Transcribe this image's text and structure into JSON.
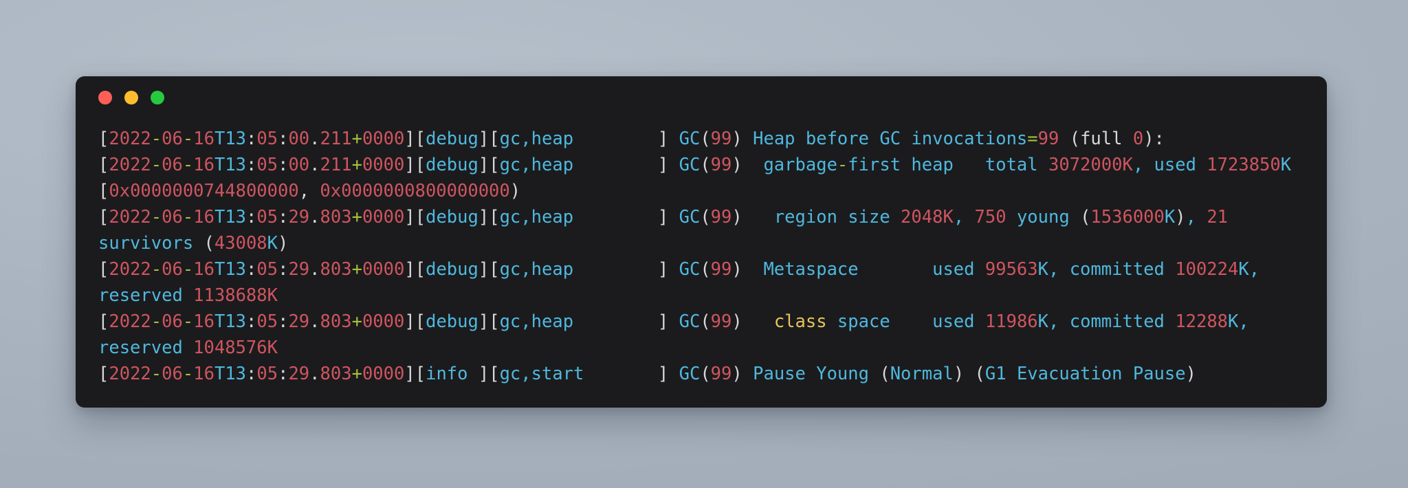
{
  "window": {
    "title": "",
    "controls": [
      {
        "name": "close",
        "color": "#ff5f56"
      },
      {
        "name": "minimize",
        "color": "#ffbd2e"
      },
      {
        "name": "zoom",
        "color": "#27c93f"
      }
    ]
  },
  "theme": {
    "desktop_background": "#aab4c0",
    "terminal_background": "#1b1b1d",
    "white": "#d8d8d8",
    "red": "#cf5560",
    "cyan": "#4fb8de",
    "green": "#a6c23a",
    "yellow": "#e5c55a"
  },
  "terminal": {
    "lines": [
      {
        "id": "line-1",
        "plain": "[2022-06-16T13:05:00.211+0000][debug][gc,heap        ] GC(99) Heap before GC invocations=99 (full 0):",
        "tokens": [
          {
            "t": "[",
            "c": "w"
          },
          {
            "t": "2022",
            "c": "r"
          },
          {
            "t": "-",
            "c": "g"
          },
          {
            "t": "06",
            "c": "r"
          },
          {
            "t": "-",
            "c": "g"
          },
          {
            "t": "16",
            "c": "r"
          },
          {
            "t": "T",
            "c": "c"
          },
          {
            "t": "13",
            "c": "c"
          },
          {
            "t": ":",
            "c": "w"
          },
          {
            "t": "05",
            "c": "r"
          },
          {
            "t": ":",
            "c": "w"
          },
          {
            "t": "00",
            "c": "r"
          },
          {
            "t": ".",
            "c": "w"
          },
          {
            "t": "211",
            "c": "r"
          },
          {
            "t": "+",
            "c": "g"
          },
          {
            "t": "0000",
            "c": "r"
          },
          {
            "t": "][",
            "c": "w"
          },
          {
            "t": "debug",
            "c": "c"
          },
          {
            "t": "][",
            "c": "w"
          },
          {
            "t": "gc,heap",
            "c": "c"
          },
          {
            "t": "        ",
            "c": "w"
          },
          {
            "t": "] ",
            "c": "w"
          },
          {
            "t": "GC",
            "c": "c"
          },
          {
            "t": "(",
            "c": "w"
          },
          {
            "t": "99",
            "c": "r"
          },
          {
            "t": ") ",
            "c": "w"
          },
          {
            "t": "Heap before GC invocations",
            "c": "c"
          },
          {
            "t": "=",
            "c": "g"
          },
          {
            "t": "99",
            "c": "r"
          },
          {
            "t": " (full ",
            "c": "w"
          },
          {
            "t": "0",
            "c": "r"
          },
          {
            "t": "):",
            "c": "w"
          }
        ]
      },
      {
        "id": "line-2",
        "plain": "[2022-06-16T13:05:00.211+0000][debug][gc,heap        ] GC(99)  garbage-first heap   total 3072000K, used 1723850K [0x0000000744800000, 0x0000000800000000)",
        "tokens": [
          {
            "t": "[",
            "c": "w"
          },
          {
            "t": "2022",
            "c": "r"
          },
          {
            "t": "-",
            "c": "g"
          },
          {
            "t": "06",
            "c": "r"
          },
          {
            "t": "-",
            "c": "g"
          },
          {
            "t": "16",
            "c": "r"
          },
          {
            "t": "T",
            "c": "c"
          },
          {
            "t": "13",
            "c": "c"
          },
          {
            "t": ":",
            "c": "w"
          },
          {
            "t": "05",
            "c": "r"
          },
          {
            "t": ":",
            "c": "w"
          },
          {
            "t": "00",
            "c": "r"
          },
          {
            "t": ".",
            "c": "w"
          },
          {
            "t": "211",
            "c": "r"
          },
          {
            "t": "+",
            "c": "g"
          },
          {
            "t": "0000",
            "c": "r"
          },
          {
            "t": "][",
            "c": "w"
          },
          {
            "t": "debug",
            "c": "c"
          },
          {
            "t": "][",
            "c": "w"
          },
          {
            "t": "gc,heap",
            "c": "c"
          },
          {
            "t": "        ",
            "c": "w"
          },
          {
            "t": "] ",
            "c": "w"
          },
          {
            "t": "GC",
            "c": "c"
          },
          {
            "t": "(",
            "c": "w"
          },
          {
            "t": "99",
            "c": "r"
          },
          {
            "t": ")  ",
            "c": "w"
          },
          {
            "t": "garbage",
            "c": "c"
          },
          {
            "t": "-",
            "c": "g"
          },
          {
            "t": "first heap   total ",
            "c": "c"
          },
          {
            "t": "3072000K",
            "c": "r"
          },
          {
            "t": ", ",
            "c": "c"
          },
          {
            "t": "used ",
            "c": "c"
          },
          {
            "t": "1723850",
            "c": "r"
          },
          {
            "t": "K",
            "c": "c"
          },
          {
            "t": " [",
            "c": "w"
          },
          {
            "t": "0x0000000744800000",
            "c": "r"
          },
          {
            "t": ", ",
            "c": "w"
          },
          {
            "t": "0x0000000800000000",
            "c": "r"
          },
          {
            "t": ")",
            "c": "w"
          }
        ]
      },
      {
        "id": "line-3",
        "plain": "[2022-06-16T13:05:29.803+0000][debug][gc,heap        ] GC(99)   region size 2048K, 750 young (1536000K), 21 survivors (43008K)",
        "tokens": [
          {
            "t": "[",
            "c": "w"
          },
          {
            "t": "2022",
            "c": "r"
          },
          {
            "t": "-",
            "c": "g"
          },
          {
            "t": "06",
            "c": "r"
          },
          {
            "t": "-",
            "c": "g"
          },
          {
            "t": "16",
            "c": "r"
          },
          {
            "t": "T",
            "c": "c"
          },
          {
            "t": "13",
            "c": "c"
          },
          {
            "t": ":",
            "c": "w"
          },
          {
            "t": "05",
            "c": "r"
          },
          {
            "t": ":",
            "c": "w"
          },
          {
            "t": "29",
            "c": "r"
          },
          {
            "t": ".",
            "c": "w"
          },
          {
            "t": "803",
            "c": "r"
          },
          {
            "t": "+",
            "c": "g"
          },
          {
            "t": "0000",
            "c": "r"
          },
          {
            "t": "][",
            "c": "w"
          },
          {
            "t": "debug",
            "c": "c"
          },
          {
            "t": "][",
            "c": "w"
          },
          {
            "t": "gc,heap",
            "c": "c"
          },
          {
            "t": "        ",
            "c": "w"
          },
          {
            "t": "] ",
            "c": "w"
          },
          {
            "t": "GC",
            "c": "c"
          },
          {
            "t": "(",
            "c": "w"
          },
          {
            "t": "99",
            "c": "r"
          },
          {
            "t": ")   ",
            "c": "w"
          },
          {
            "t": "region size ",
            "c": "c"
          },
          {
            "t": "2048K",
            "c": "r"
          },
          {
            "t": ", ",
            "c": "c"
          },
          {
            "t": "750",
            "c": "r"
          },
          {
            "t": " young ",
            "c": "c"
          },
          {
            "t": "(",
            "c": "w"
          },
          {
            "t": "1536000",
            "c": "r"
          },
          {
            "t": "K",
            "c": "c"
          },
          {
            "t": ")",
            "c": "w"
          },
          {
            "t": ", ",
            "c": "c"
          },
          {
            "t": "21",
            "c": "r"
          },
          {
            "t": " survivors ",
            "c": "c"
          },
          {
            "t": "(",
            "c": "w"
          },
          {
            "t": "43008",
            "c": "r"
          },
          {
            "t": "K",
            "c": "c"
          },
          {
            "t": ")",
            "c": "w"
          }
        ]
      },
      {
        "id": "line-4",
        "plain": "[2022-06-16T13:05:29.803+0000][debug][gc,heap        ] GC(99)  Metaspace       used 99563K, committed 100224K, reserved 1138688K",
        "tokens": [
          {
            "t": "[",
            "c": "w"
          },
          {
            "t": "2022",
            "c": "r"
          },
          {
            "t": "-",
            "c": "g"
          },
          {
            "t": "06",
            "c": "r"
          },
          {
            "t": "-",
            "c": "g"
          },
          {
            "t": "16",
            "c": "r"
          },
          {
            "t": "T",
            "c": "c"
          },
          {
            "t": "13",
            "c": "c"
          },
          {
            "t": ":",
            "c": "w"
          },
          {
            "t": "05",
            "c": "r"
          },
          {
            "t": ":",
            "c": "w"
          },
          {
            "t": "29",
            "c": "r"
          },
          {
            "t": ".",
            "c": "w"
          },
          {
            "t": "803",
            "c": "r"
          },
          {
            "t": "+",
            "c": "g"
          },
          {
            "t": "0000",
            "c": "r"
          },
          {
            "t": "][",
            "c": "w"
          },
          {
            "t": "debug",
            "c": "c"
          },
          {
            "t": "][",
            "c": "w"
          },
          {
            "t": "gc,heap",
            "c": "c"
          },
          {
            "t": "        ",
            "c": "w"
          },
          {
            "t": "] ",
            "c": "w"
          },
          {
            "t": "GC",
            "c": "c"
          },
          {
            "t": "(",
            "c": "w"
          },
          {
            "t": "99",
            "c": "r"
          },
          {
            "t": ")  ",
            "c": "w"
          },
          {
            "t": "Metaspace",
            "c": "c"
          },
          {
            "t": "       ",
            "c": "c"
          },
          {
            "t": "used ",
            "c": "c"
          },
          {
            "t": "99563",
            "c": "r"
          },
          {
            "t": "K",
            "c": "c"
          },
          {
            "t": ", ",
            "c": "c"
          },
          {
            "t": "committed ",
            "c": "c"
          },
          {
            "t": "100224",
            "c": "r"
          },
          {
            "t": "K",
            "c": "c"
          },
          {
            "t": ", ",
            "c": "c"
          },
          {
            "t": "reserved ",
            "c": "c"
          },
          {
            "t": "1138688K",
            "c": "r"
          }
        ]
      },
      {
        "id": "line-5",
        "plain": "[2022-06-16T13:05:29.803+0000][debug][gc,heap        ] GC(99)   class space    used 11986K, committed 12288K, reserved 1048576K",
        "tokens": [
          {
            "t": "[",
            "c": "w"
          },
          {
            "t": "2022",
            "c": "r"
          },
          {
            "t": "-",
            "c": "g"
          },
          {
            "t": "06",
            "c": "r"
          },
          {
            "t": "-",
            "c": "g"
          },
          {
            "t": "16",
            "c": "r"
          },
          {
            "t": "T",
            "c": "c"
          },
          {
            "t": "13",
            "c": "c"
          },
          {
            "t": ":",
            "c": "w"
          },
          {
            "t": "05",
            "c": "r"
          },
          {
            "t": ":",
            "c": "w"
          },
          {
            "t": "29",
            "c": "r"
          },
          {
            "t": ".",
            "c": "w"
          },
          {
            "t": "803",
            "c": "r"
          },
          {
            "t": "+",
            "c": "g"
          },
          {
            "t": "0000",
            "c": "r"
          },
          {
            "t": "][",
            "c": "w"
          },
          {
            "t": "debug",
            "c": "c"
          },
          {
            "t": "][",
            "c": "w"
          },
          {
            "t": "gc,heap",
            "c": "c"
          },
          {
            "t": "        ",
            "c": "w"
          },
          {
            "t": "] ",
            "c": "w"
          },
          {
            "t": "GC",
            "c": "c"
          },
          {
            "t": "(",
            "c": "w"
          },
          {
            "t": "99",
            "c": "r"
          },
          {
            "t": ")   ",
            "c": "w"
          },
          {
            "t": "class",
            "c": "y"
          },
          {
            "t": " space",
            "c": "c"
          },
          {
            "t": "    ",
            "c": "c"
          },
          {
            "t": "used ",
            "c": "c"
          },
          {
            "t": "11986",
            "c": "r"
          },
          {
            "t": "K",
            "c": "c"
          },
          {
            "t": ", ",
            "c": "c"
          },
          {
            "t": "committed ",
            "c": "c"
          },
          {
            "t": "12288",
            "c": "r"
          },
          {
            "t": "K",
            "c": "c"
          },
          {
            "t": ", ",
            "c": "c"
          },
          {
            "t": "reserved ",
            "c": "c"
          },
          {
            "t": "1048576K",
            "c": "r"
          }
        ]
      },
      {
        "id": "line-6",
        "plain": "[2022-06-16T13:05:29.803+0000][info ][gc,start       ] GC(99) Pause Young (Normal) (G1 Evacuation Pause)",
        "tokens": [
          {
            "t": "[",
            "c": "w"
          },
          {
            "t": "2022",
            "c": "r"
          },
          {
            "t": "-",
            "c": "g"
          },
          {
            "t": "06",
            "c": "r"
          },
          {
            "t": "-",
            "c": "g"
          },
          {
            "t": "16",
            "c": "r"
          },
          {
            "t": "T",
            "c": "c"
          },
          {
            "t": "13",
            "c": "c"
          },
          {
            "t": ":",
            "c": "w"
          },
          {
            "t": "05",
            "c": "r"
          },
          {
            "t": ":",
            "c": "w"
          },
          {
            "t": "29",
            "c": "r"
          },
          {
            "t": ".",
            "c": "w"
          },
          {
            "t": "803",
            "c": "r"
          },
          {
            "t": "+",
            "c": "g"
          },
          {
            "t": "0000",
            "c": "r"
          },
          {
            "t": "][",
            "c": "w"
          },
          {
            "t": "info ",
            "c": "c"
          },
          {
            "t": "][",
            "c": "w"
          },
          {
            "t": "gc,start",
            "c": "c"
          },
          {
            "t": "       ",
            "c": "w"
          },
          {
            "t": "] ",
            "c": "w"
          },
          {
            "t": "GC",
            "c": "c"
          },
          {
            "t": "(",
            "c": "w"
          },
          {
            "t": "99",
            "c": "r"
          },
          {
            "t": ") ",
            "c": "w"
          },
          {
            "t": "Pause Young ",
            "c": "c"
          },
          {
            "t": "(",
            "c": "w"
          },
          {
            "t": "Normal",
            "c": "c"
          },
          {
            "t": ") (",
            "c": "w"
          },
          {
            "t": "G1 Evacuation Pause",
            "c": "c"
          },
          {
            "t": ")",
            "c": "w"
          }
        ]
      }
    ]
  }
}
